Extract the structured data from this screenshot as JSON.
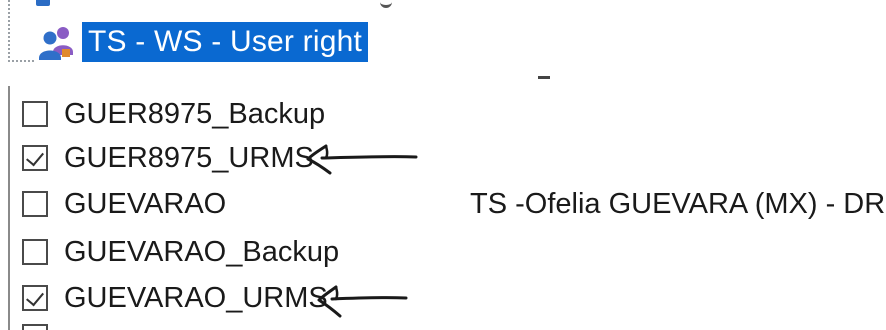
{
  "tree": {
    "group_label": "TS - WS - User right",
    "group_icon": "group-users-icon"
  },
  "accounts": [
    {
      "name": "GUER8975_Backup",
      "checked": false,
      "description": ""
    },
    {
      "name": "GUER8975_URMS",
      "checked": true,
      "description": ""
    },
    {
      "name": "GUEVARAO",
      "checked": false,
      "description": "TS -Ofelia GUEVARA (MX) - DRP"
    },
    {
      "name": "GUEVARAO_Backup",
      "checked": false,
      "description": ""
    },
    {
      "name": "GUEVARAO_URMS",
      "checked": true,
      "description": ""
    }
  ],
  "colors": {
    "selection": "#0a69d1",
    "annotation": "#1a1a1a"
  },
  "annotations": [
    {
      "type": "hand-drawn-arrow",
      "points_to": "GUER8975_URMS"
    },
    {
      "type": "hand-drawn-arrow",
      "points_to": "GUEVARAO_URMS"
    }
  ]
}
